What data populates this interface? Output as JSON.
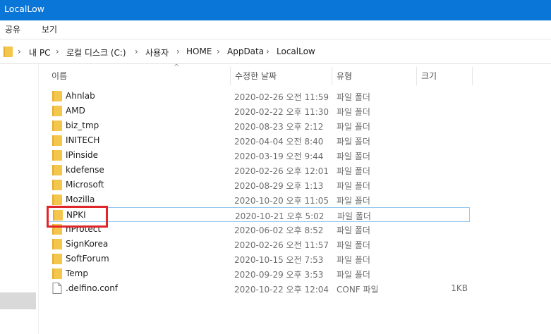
{
  "window": {
    "title": "LocalLow"
  },
  "menu": {
    "share": "공유",
    "view": "보기"
  },
  "breadcrumb": {
    "items": [
      "내 PC",
      "로컬 디스크 (C:)",
      "사용자",
      "HOME",
      "AppData",
      "LocalLow"
    ],
    "separator": "›"
  },
  "columns": {
    "name": "이름",
    "date": "수정한 날짜",
    "type": "유형",
    "size": "크기"
  },
  "files": [
    {
      "name": "Ahnlab",
      "date": "2020-02-26 오전 11:59",
      "type": "파일 폴더",
      "size": ""
    },
    {
      "name": "AMD",
      "date": "2020-02-22 오후 11:30",
      "type": "파일 폴더",
      "size": ""
    },
    {
      "name": "biz_tmp",
      "date": "2020-08-23 오후 2:12",
      "type": "파일 폴더",
      "size": ""
    },
    {
      "name": "INITECH",
      "date": "2020-04-04 오전 8:40",
      "type": "파일 폴더",
      "size": ""
    },
    {
      "name": "IPinside",
      "date": "2020-03-19 오전 9:44",
      "type": "파일 폴더",
      "size": ""
    },
    {
      "name": "kdefense",
      "date": "2020-02-26 오후 12:01",
      "type": "파일 폴더",
      "size": ""
    },
    {
      "name": "Microsoft",
      "date": "2020-08-29 오후 1:13",
      "type": "파일 폴더",
      "size": ""
    },
    {
      "name": "Mozilla",
      "date": "2020-10-20 오후 11:05",
      "type": "파일 폴더",
      "size": ""
    },
    {
      "name": "NPKI",
      "date": "2020-10-21 오후 5:02",
      "type": "파일 폴더",
      "size": ""
    },
    {
      "name": "nProtect",
      "date": "2020-06-02 오후 8:52",
      "type": "파일 폴더",
      "size": ""
    },
    {
      "name": "SignKorea",
      "date": "2020-02-26 오전 11:57",
      "type": "파일 폴더",
      "size": ""
    },
    {
      "name": "SoftForum",
      "date": "2020-10-15 오전 7:53",
      "type": "파일 폴더",
      "size": ""
    },
    {
      "name": "Temp",
      "date": "2020-09-29 오후 3:53",
      "type": "파일 폴더",
      "size": ""
    },
    {
      "name": ".delfino.conf",
      "date": "2020-10-22 오후 12:04",
      "type": "CONF 파일",
      "size": "1KB"
    }
  ],
  "colors": {
    "titlebar": "#0a76d8",
    "folder": "#f4c64c",
    "highlight": "#e0262a",
    "selection_border": "#99c9ef"
  },
  "icons": {
    "folder": "folder-icon",
    "file": "file-icon",
    "sort": "sort-up-icon"
  }
}
